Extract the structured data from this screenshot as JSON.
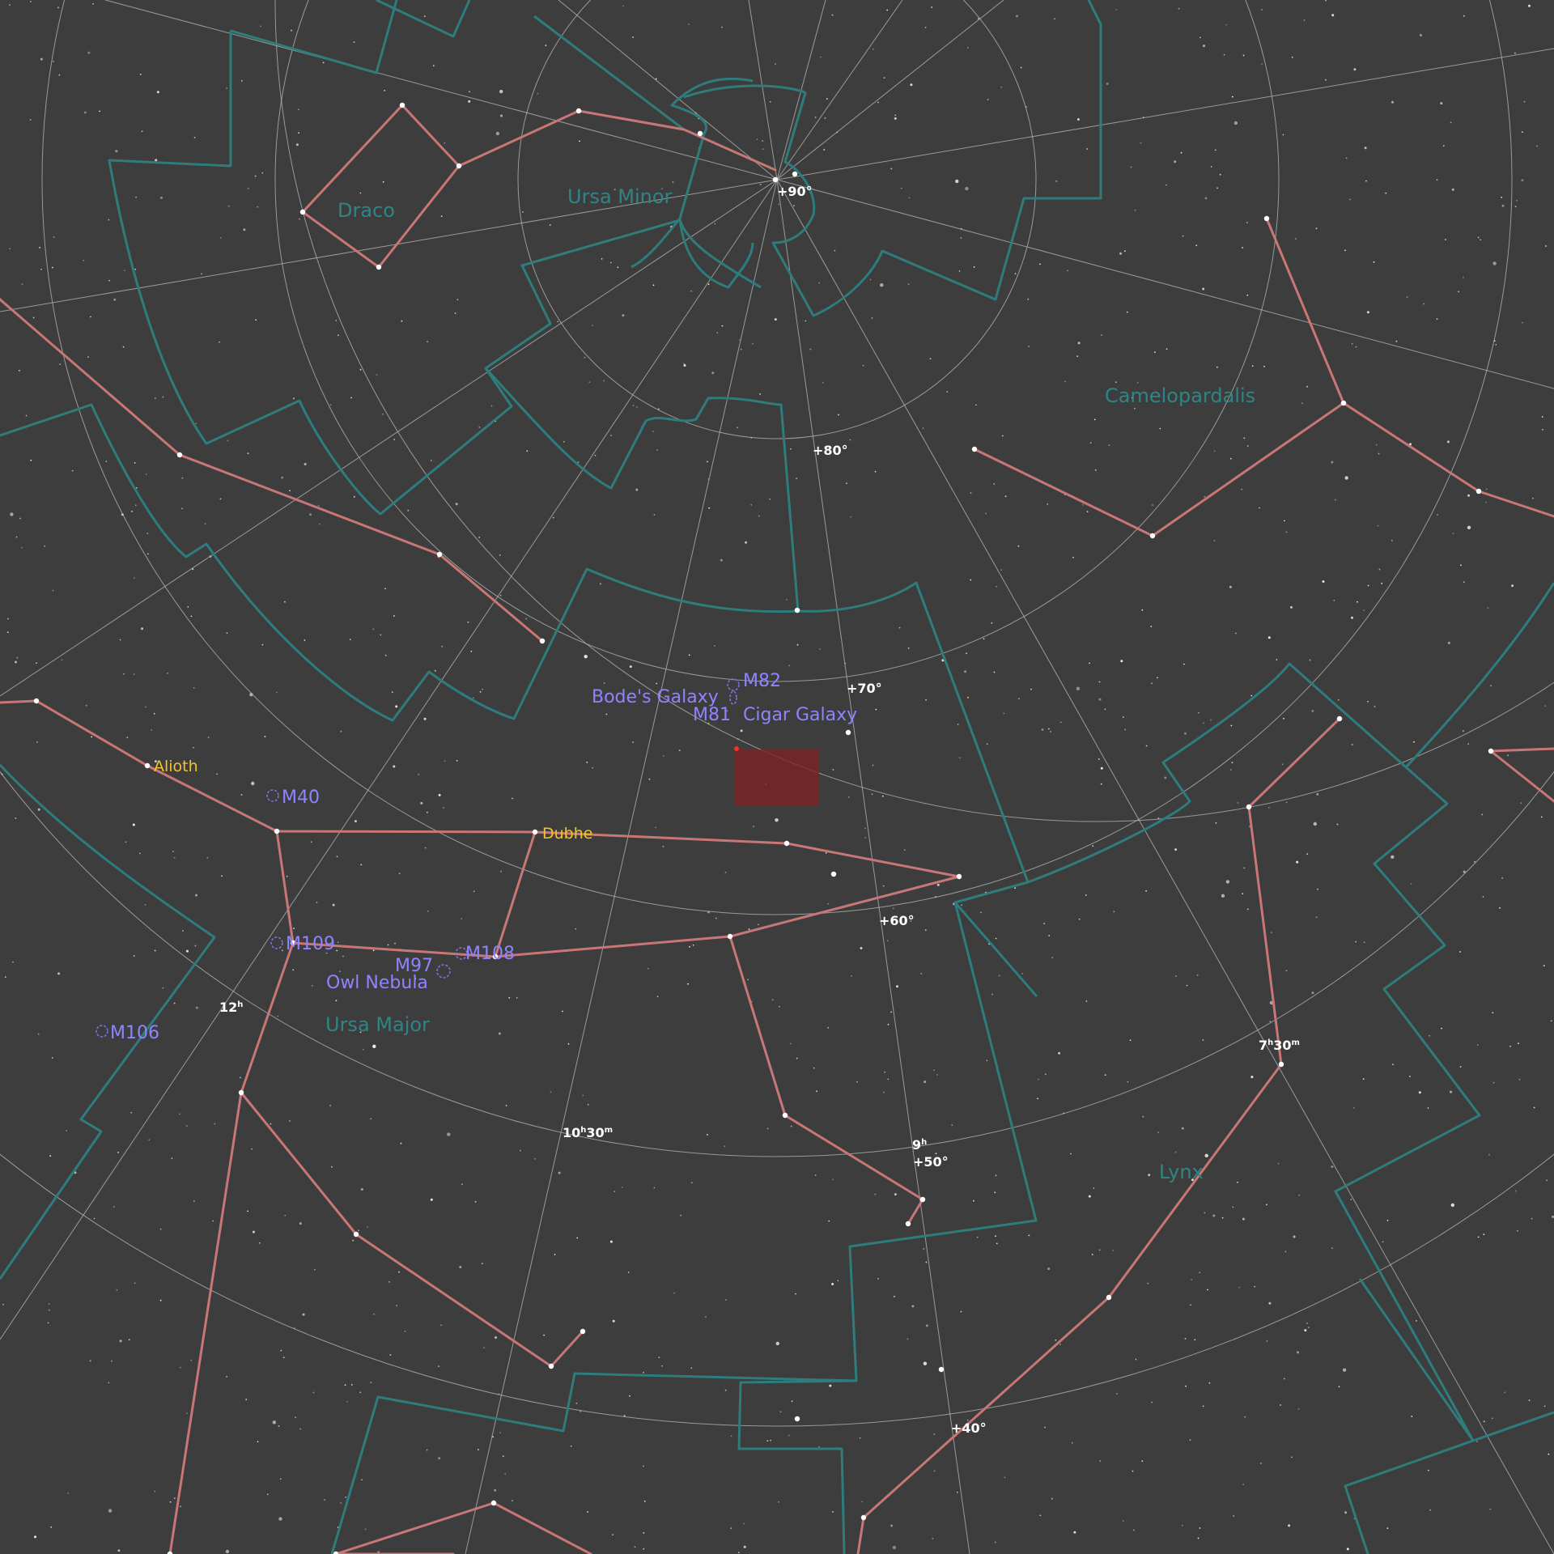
{
  "colors": {
    "background": "#3d3d3d",
    "grid": "#b9b9b9",
    "constellation_boundary": "#2f7c7c",
    "constellation_line": "#c97676",
    "constellation_name": "#2f8585",
    "deep_sky_label": "#8f84ff",
    "star_name": "#f2c42c",
    "field_frame": "#7a2323"
  },
  "declination_labels": [
    "+90°",
    "+80°",
    "+70°",
    "+60°",
    "+50°",
    "+40°"
  ],
  "ra_labels": [
    {
      "h": "12",
      "m": ""
    },
    {
      "h": "10",
      "m": "30"
    },
    {
      "h": "9",
      "m": ""
    },
    {
      "h": "7",
      "m": "30"
    }
  ],
  "constellations": [
    "Draco",
    "Ursa Minor",
    "Camelopardalis",
    "Ursa Major",
    "Lynx"
  ],
  "deep_sky_objects": [
    "M82",
    "Bode's Galaxy",
    "M81",
    "Cigar Galaxy",
    "M40",
    "M109",
    "M108",
    "M97",
    "Owl Nebula",
    "M106"
  ],
  "named_stars": [
    "Alioth",
    "Dubhe"
  ]
}
